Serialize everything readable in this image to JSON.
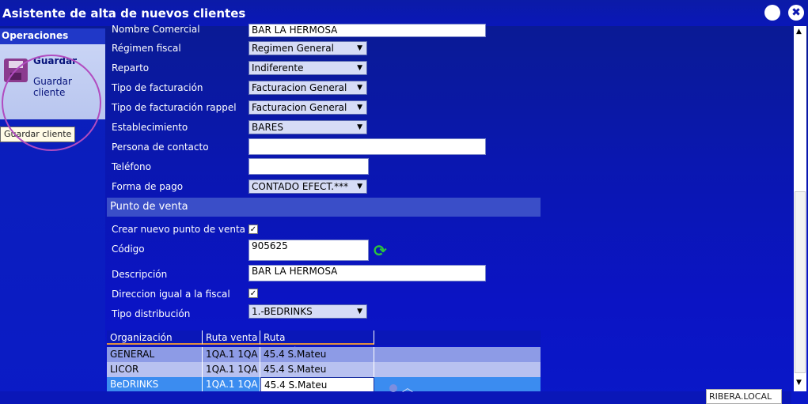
{
  "window": {
    "title": "Asistente de alta de nuevos clientes"
  },
  "sidebar": {
    "header": "Operaciones",
    "save_title": "Guardar",
    "save_subtitle": "Guardar cliente",
    "tooltip": "Guardar cliente"
  },
  "form": {
    "nombre_comercial": {
      "label": "Nombre Comercial",
      "value": "BAR LA HERMOSA"
    },
    "regimen_fiscal": {
      "label": "Régimen fiscal",
      "value": "Regimen General"
    },
    "reparto": {
      "label": "Reparto",
      "value": "Indiferente"
    },
    "tipo_facturacion": {
      "label": "Tipo de facturación",
      "value": "Facturacion General"
    },
    "tipo_facturacion_rappel": {
      "label": "Tipo de facturación rappel",
      "value": "Facturacion General"
    },
    "establecimiento": {
      "label": "Establecimiento",
      "value": "BARES"
    },
    "persona_contacto": {
      "label": "Persona de contacto",
      "value": ""
    },
    "telefono": {
      "label": "Teléfono",
      "value": ""
    },
    "forma_pago": {
      "label": "Forma de pago",
      "value": "CONTADO EFECT.***"
    }
  },
  "punto_venta": {
    "header": "Punto de venta",
    "crear_nuevo": {
      "label": "Crear nuevo punto de venta",
      "checked": true
    },
    "codigo": {
      "label": "Código",
      "value": "905625"
    },
    "descripcion": {
      "label": "Descripción",
      "value": "BAR LA HERMOSA"
    },
    "direccion_igual": {
      "label": "Direccion igual a la fiscal",
      "checked": true
    },
    "tipo_distribucion": {
      "label": "Tipo distribución",
      "value": "1.-BEDRINKS"
    }
  },
  "grid": {
    "columns": [
      "Organización venta",
      "Ruta venta",
      "Ruta geográfica/reparto"
    ],
    "rows": [
      [
        "GENERAL",
        "1QA.1 1QA",
        "45.4 S.Mateu"
      ],
      [
        "LICOR",
        "1QA.1 1QA",
        "45.4 S.Mateu"
      ],
      [
        "BeDRINKS",
        "1QA.1 1QA",
        "45.4 S.Mateu"
      ]
    ]
  },
  "status": {
    "server": "RIBERA.LOCAL"
  }
}
